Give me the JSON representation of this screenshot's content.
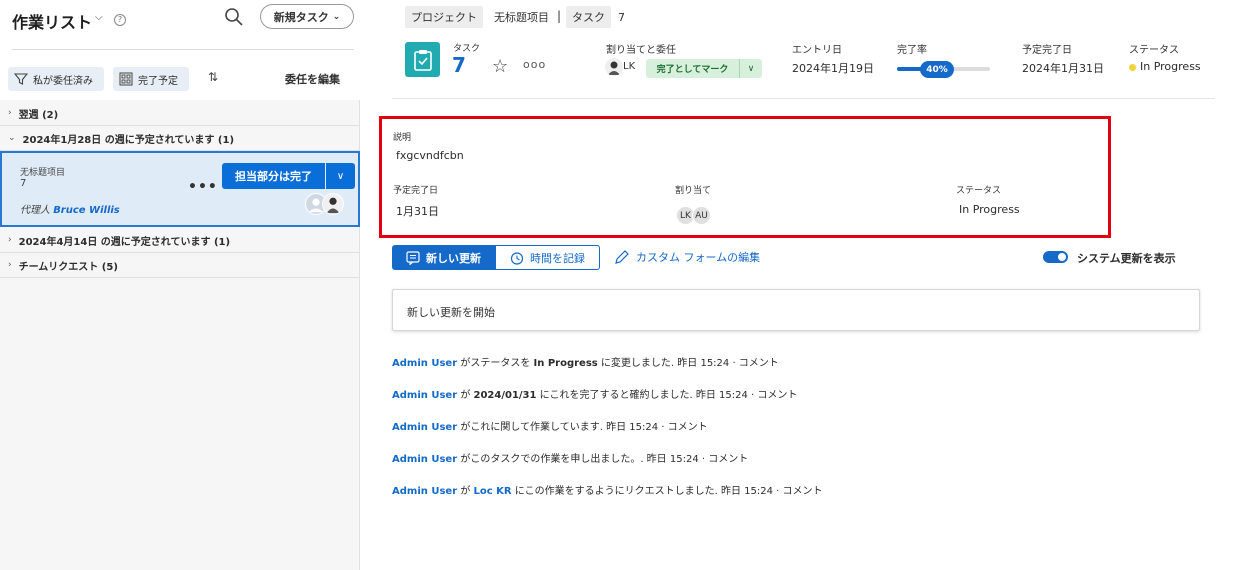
{
  "left": {
    "title": "作業リスト",
    "new_task": "新規タスク",
    "filters": {
      "assigned_by_me": "私が委任済み",
      "due_complete": "完了予定"
    },
    "delegate_edit": "委任を編集",
    "groups": [
      {
        "label": "翌週 (2)"
      },
      {
        "label": "2024年1月28日 の週に予定されています (1)"
      },
      {
        "label": "2024年4月14日 の週に予定されています (1)"
      },
      {
        "label": "チームリクエスト (5)"
      }
    ],
    "card": {
      "name": "无标题项目",
      "number": "7",
      "done_label": "担当部分は完了",
      "proxy_prefix": "代理人",
      "proxy_name": "Bruce Willis"
    }
  },
  "breadcrumb": {
    "project_tag": "プロジェクト",
    "project_name": "无标题项目",
    "task_tag": "タスク",
    "task_number": "7"
  },
  "header": {
    "type_label": "タスク",
    "number": "7",
    "assign_label": "割り当てと委任",
    "assignee_initials": "LK",
    "mark_done": "完了としてマーク",
    "entry_label": "エントリ日",
    "entry_value": "2024年1月19日",
    "progress_label": "完了率",
    "progress_percent": 40,
    "progress_text": "40%",
    "due_label": "予定完了日",
    "due_value": "2024年1月31日",
    "status_label": "ステータス",
    "status_value": "In Progress",
    "status_color": "#f3d23a"
  },
  "details": {
    "desc_label": "説明",
    "desc_value": "fxgcvndfcbn",
    "due_label": "予定完了日",
    "due_value": "1月31日",
    "assign_label": "割り当て",
    "assignee_1": "LK",
    "assignee_2": "AU",
    "status_label": "ステータス",
    "status_value": "In Progress"
  },
  "tabs": {
    "new_update": "新しい更新",
    "log_time": "時間を記録",
    "custom_form": "カスタム フォームの編集",
    "system_updates": "システム更新を表示"
  },
  "update_placeholder": "新しい更新を開始",
  "feed": [
    {
      "user": "Admin User",
      "text1": " がステータスを ",
      "strong": "In Progress",
      "text2": " に変更しました.",
      "meta": " 昨日 15:24 · コメント"
    },
    {
      "user": "Admin User",
      "text1": " が ",
      "strong": "2024/01/31",
      "text2": " にこれを完了すると確約しました.",
      "meta": " 昨日 15:24 · コメント"
    },
    {
      "user": "Admin User",
      "text1": " がこれに関して作業しています.",
      "strong": "",
      "text2": "",
      "meta": " 昨日 15:24 · コメント"
    },
    {
      "user": "Admin User",
      "text1": " がこのタスクでの作業を申し出ました。.",
      "strong": "",
      "text2": "",
      "meta": " 昨日 15:24 · コメント"
    },
    {
      "user": "Admin User",
      "text1": " が ",
      "user2": "Loc KR",
      "text2": " にこの作業をするようにリクエストしました.",
      "meta": " 昨日 15:24 · コメント"
    }
  ]
}
